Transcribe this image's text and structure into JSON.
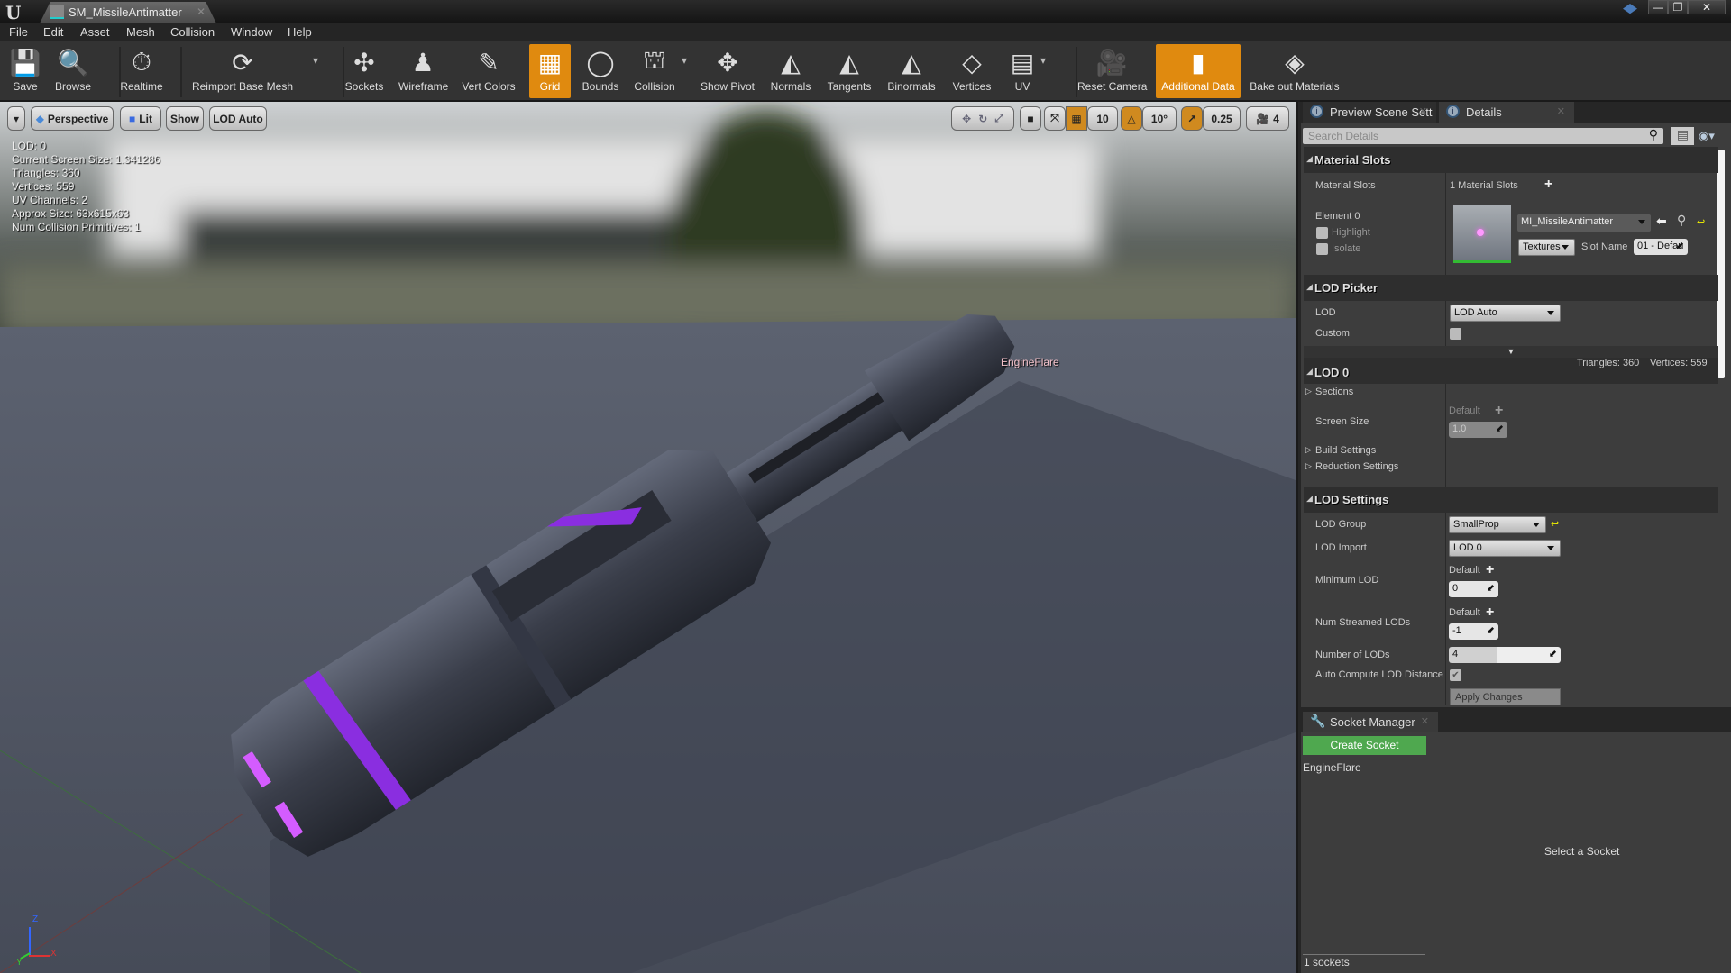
{
  "window": {
    "tab_title": "SM_MissileAntimatter",
    "controls": [
      "—",
      "❐",
      "✕"
    ]
  },
  "menu": [
    "File",
    "Edit",
    "Asset",
    "Mesh",
    "Collision",
    "Window",
    "Help"
  ],
  "toolbar": [
    {
      "label": "Save",
      "icon": "save-icon",
      "glyph": "💾"
    },
    {
      "label": "Browse",
      "icon": "magnifier-icon",
      "glyph": "🔍"
    },
    {
      "label": "Realtime",
      "icon": "stopwatch-icon",
      "glyph": "⏱"
    },
    {
      "label": "Reimport Base Mesh",
      "icon": "reimport-icon",
      "glyph": "⟳",
      "dropdown": true
    },
    {
      "label": "Sockets",
      "icon": "socket-icon",
      "glyph": "✣"
    },
    {
      "label": "Wireframe",
      "icon": "wireframe-icon",
      "glyph": "♟"
    },
    {
      "label": "Vert Colors",
      "icon": "vertex-colors-icon",
      "glyph": "✎"
    },
    {
      "label": "Grid",
      "icon": "grid-icon",
      "glyph": "▦",
      "active": true
    },
    {
      "label": "Bounds",
      "icon": "bounds-icon",
      "glyph": "◯"
    },
    {
      "label": "Collision",
      "icon": "collision-icon",
      "glyph": "⛫",
      "dropdown": true
    },
    {
      "label": "Show Pivot",
      "icon": "pivot-icon",
      "glyph": "✥"
    },
    {
      "label": "Normals",
      "icon": "normals-icon",
      "glyph": "◭"
    },
    {
      "label": "Tangents",
      "icon": "tangents-icon",
      "glyph": "◭"
    },
    {
      "label": "Binormals",
      "icon": "binormals-icon",
      "glyph": "◭"
    },
    {
      "label": "Vertices",
      "icon": "vertices-icon",
      "glyph": "◇"
    },
    {
      "label": "UV",
      "icon": "uv-icon",
      "glyph": "▤",
      "dropdown": true
    },
    {
      "label": "Reset Camera",
      "icon": "camera-icon",
      "glyph": "🎥"
    },
    {
      "label": "Additional Data",
      "icon": "additional-data-icon",
      "glyph": "▮",
      "active": true
    },
    {
      "label": "Bake out Materials",
      "icon": "bake-materials-icon",
      "glyph": "◈"
    }
  ],
  "viewport": {
    "buttons": {
      "perspective": "Perspective",
      "lit": "Lit",
      "show": "Show",
      "lod": "LOD Auto"
    },
    "snap": {
      "grid": "10",
      "rotation": "10°",
      "scale": "0.25",
      "camera_speed": "4"
    },
    "stats": [
      "LOD:  0",
      "Current Screen Size:  1.341286",
      "Triangles:  360",
      "Vertices:  559",
      "UV Channels:  2",
      "Approx Size: 63x615x63",
      "Num Collision Primitives:  1"
    ],
    "socket_label": "EngineFlare",
    "axes": {
      "x": "X",
      "y": "Y",
      "z": "Z"
    }
  },
  "panel_tabs": [
    "Preview Scene Sett",
    "Details"
  ],
  "details": {
    "search_placeholder": "Search Details",
    "material_slots": {
      "header": "Material Slots",
      "label": "Material Slots",
      "count": "1 Material Slots",
      "element": "Element 0",
      "highlight": "Highlight",
      "isolate": "Isolate",
      "material": "MI_MissileAntimatter",
      "textures": "Textures",
      "slot_name_label": "Slot Name",
      "slot_name": "01 - Defau"
    },
    "lod_picker": {
      "header": "LOD Picker",
      "lod_label": "LOD",
      "lod_value": "LOD Auto",
      "custom": "Custom"
    },
    "lod0": {
      "header": "LOD 0",
      "triangles": "Triangles: 360",
      "vertices": "Vertices: 559",
      "sections": "Sections",
      "default": "Default",
      "screen_size": "Screen Size",
      "screen_size_value": "1.0",
      "build": "Build Settings",
      "reduction": "Reduction Settings"
    },
    "lod_settings": {
      "header": "LOD Settings",
      "group_label": "LOD Group",
      "group": "SmallProp",
      "import_label": "LOD Import",
      "import": "LOD 0",
      "min_label": "Minimum LOD",
      "default": "Default",
      "min": "0",
      "streamed_label": "Num Streamed LODs",
      "streamed": "-1",
      "num_label": "Number of LODs",
      "num": "4",
      "auto_label": "Auto Compute LOD Distance",
      "auto_checked": true,
      "apply": "Apply Changes"
    }
  },
  "socket_manager": {
    "tab": "Socket Manager",
    "create": "Create Socket",
    "sockets": [
      "EngineFlare"
    ],
    "empty": "Select a Socket",
    "count": "1 sockets"
  }
}
